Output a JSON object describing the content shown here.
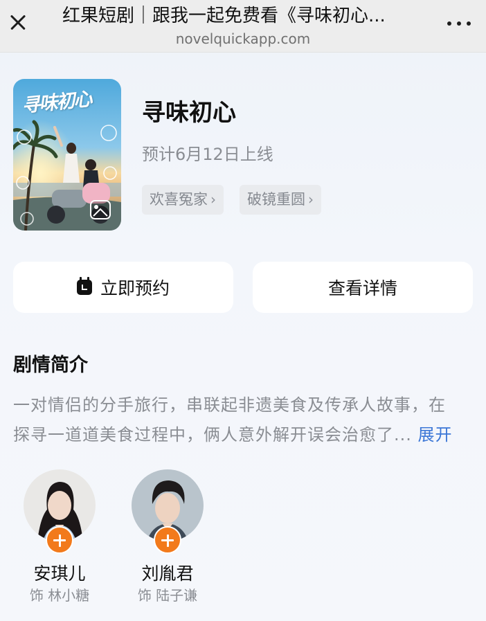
{
  "browser": {
    "title": "红果短剧｜跟我一起免费看《寻味初心...",
    "url": "novelquickapp.com"
  },
  "drama": {
    "poster_title": "寻味初心",
    "title": "寻味初心",
    "release": "预计6月12日上线",
    "tags": [
      "欢喜冤家",
      "破镜重圆"
    ]
  },
  "actions": {
    "reserve_label": "立即预约",
    "detail_label": "查看详情"
  },
  "synopsis": {
    "heading": "剧情简介",
    "line1": "一对情侣的分手旅行，串联起非遗美食及传承人故事，在",
    "line2": "探寻一道道美食过程中，俩人意外解开误会治愈了...",
    "expand_label": "展开"
  },
  "cast": [
    {
      "name": "安琪儿",
      "role": "饰 林小糖"
    },
    {
      "name": "刘胤君",
      "role": "饰 陆子谦"
    }
  ],
  "colors": {
    "accent_orange": "#f27a1b",
    "link_blue": "#3b76d6"
  }
}
